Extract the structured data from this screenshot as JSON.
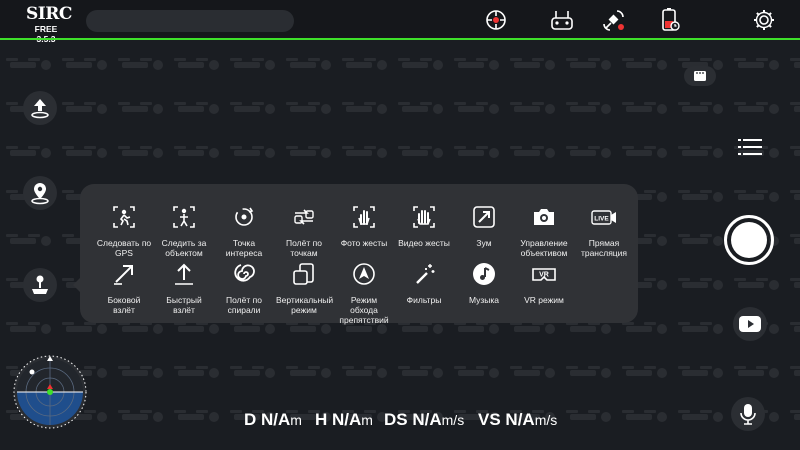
{
  "app": {
    "logo": "SIRC",
    "version": "FREE 3.5.3"
  },
  "topbar_icons": [
    "gimbal-icon",
    "remote-controller-icon",
    "satellite-icon",
    "battery-timer-icon",
    "gear-icon"
  ],
  "left_rail": [
    "takeoff-icon",
    "location-pin-icon",
    "joystick-icon"
  ],
  "modes": [
    {
      "icon": "follow-gps-icon",
      "label": "Следовать по\nGPS"
    },
    {
      "icon": "follow-object-icon",
      "label": "Следить за\nобъектом"
    },
    {
      "icon": "point-of-interest-icon",
      "label": "Точка\nинтереса"
    },
    {
      "icon": "waypoints-icon",
      "label": "Полёт по\nточкам"
    },
    {
      "icon": "photo-gesture-icon",
      "label": "Фото жесты"
    },
    {
      "icon": "video-gesture-icon",
      "label": "Видео жесты"
    },
    {
      "icon": "zoom-icon",
      "label": "Зум"
    },
    {
      "icon": "camera-control-icon",
      "label": "Управление\nобъективом"
    },
    {
      "icon": "live-stream-icon",
      "label": "Прямая\nтрансляция"
    },
    {
      "icon": "side-takeoff-icon",
      "label": "Боковой\nвзлёт"
    },
    {
      "icon": "quick-takeoff-icon",
      "label": "Быстрый\nвзлёт"
    },
    {
      "icon": "spiral-icon",
      "label": "Полёт по\nспирали"
    },
    {
      "icon": "vertical-mode-icon",
      "label": "Вертикальный\nрежим"
    },
    {
      "icon": "obstacle-avoid-icon",
      "label": "Режим обхода\nпрепятствий"
    },
    {
      "icon": "filters-icon",
      "label": "Фильтры"
    },
    {
      "icon": "music-icon",
      "label": "Музыка"
    },
    {
      "icon": "vr-mode-icon",
      "label": "VR режим"
    }
  ],
  "live_badge": "LIVE",
  "vr_badge": "VR",
  "telemetry": [
    {
      "key": "D",
      "value": "N/A",
      "unit": "m"
    },
    {
      "key": "H",
      "value": "N/A",
      "unit": "m"
    },
    {
      "key": "DS",
      "value": "N/A",
      "unit": "m/s"
    },
    {
      "key": "VS",
      "value": "N/A",
      "unit": "m/s"
    }
  ],
  "colors": {
    "accent": "#3ee02a",
    "background": "#1a1d22",
    "panel": "#303236",
    "radar_water": "#1f4e8c"
  }
}
